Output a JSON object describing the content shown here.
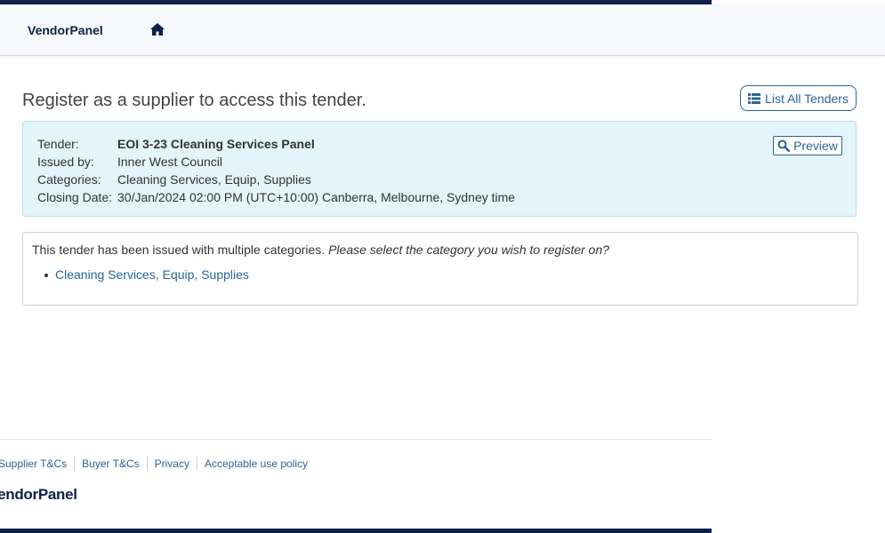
{
  "colors": {
    "brand_navy": "#0b2147",
    "link_blue": "#2a6496",
    "info_bg": "#e3f4fb"
  },
  "navbar": {
    "brand": "VendorPanel",
    "home_icon": "home-icon"
  },
  "page": {
    "title": "Register as a supplier to access this tender."
  },
  "toolbar": {
    "list_all_label": "List All Tenders",
    "list_icon": "list-icon"
  },
  "tender": {
    "tender_label": "Tender:",
    "tender_value": "EOI 3-23 Cleaning Services Panel",
    "issued_label": "Issued by:",
    "issued_value": "Inner West Council",
    "categories_label": "Categories:",
    "categories_value": "Cleaning Services, Equip, Supplies",
    "closing_label": "Closing Date:",
    "closing_value": "30/Jan/2024 02:00 PM (UTC+10:00) Canberra, Melbourne, Sydney time",
    "preview_label": "Preview",
    "preview_icon": "search-icon"
  },
  "categories_box": {
    "intro": "This tender has been issued with multiple categories.",
    "prompt": "Please select the category you wish to register on?",
    "items": [
      "Cleaning Services, Equip, Supplies"
    ]
  },
  "footer": {
    "links": [
      "Supplier T&Cs",
      "Buyer T&Cs",
      "Privacy",
      "Acceptable use policy"
    ],
    "logo": "VendorPanel"
  }
}
